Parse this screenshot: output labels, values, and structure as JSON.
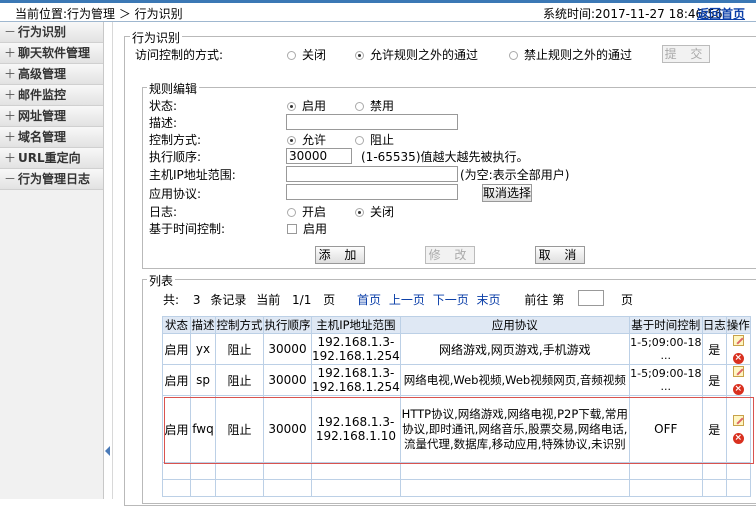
{
  "topbar": {
    "location": "当前位置:行为管理 ＞ 行为识别",
    "system_time": "系统时间:2017-11-27 18:46:56",
    "home": "返回首页"
  },
  "sidebar": {
    "items": [
      {
        "label": "行为识别",
        "glyph": "－"
      },
      {
        "label": "聊天软件管理",
        "glyph": "＋"
      },
      {
        "label": "高级管理",
        "glyph": "＋"
      },
      {
        "label": "邮件监控",
        "glyph": "＋"
      },
      {
        "label": "网址管理",
        "glyph": "＋"
      },
      {
        "label": "域名管理",
        "glyph": "＋"
      },
      {
        "label": "URL重定向",
        "glyph": "＋"
      },
      {
        "label": "行为管理日志",
        "glyph": "－"
      }
    ]
  },
  "section": {
    "legend": "行为识别",
    "access_label": "访问控制的方式:",
    "opt_off": "关闭",
    "opt_allow_except": "允许规则之外的通过",
    "opt_deny_except": "禁止规则之外的通过",
    "submit": "提 交"
  },
  "rule": {
    "legend": "规则编辑",
    "status_label": "状态:",
    "status_on": "启用",
    "status_off": "禁用",
    "desc_label": "描述:",
    "desc_value": "",
    "control_label": "控制方式:",
    "control_allow": "允许",
    "control_block": "阻止",
    "order_label": "执行顺序:",
    "order_value": "30000",
    "order_hint": "(1-65535)值越大越先被执行。",
    "ip_label": "主机IP地址范围:",
    "ip_value": "",
    "ip_hint": "(为空:表示全部用户)",
    "proto_label": "应用协议:",
    "proto_value": "",
    "proto_cancel": "取消选择",
    "log_label": "日志:",
    "log_on": "开启",
    "log_off": "关闭",
    "time_label": "基于时间控制:",
    "time_enable": "启用",
    "btn_add": "添 加",
    "btn_edit": "修 改",
    "btn_cancel": "取 消"
  },
  "list": {
    "legend": "列表",
    "total_prefix": "共:",
    "total": "3",
    "total_suffix": "条记录",
    "current_label": "当前",
    "page": "1/1",
    "page_suffix": "页",
    "first": "首页",
    "prev": "上一页",
    "next": "下一页",
    "last": "末页",
    "goto_label": "前往 第",
    "goto_value": "",
    "goto_suffix": "页",
    "headers": [
      "状态",
      "描述",
      "控制方式",
      "执行顺序",
      "主机IP地址范围",
      "应用协议",
      "基于时间控制",
      "日志",
      "操作"
    ],
    "rows": [
      {
        "status": "启用",
        "desc": "yx",
        "control": "阻止",
        "order": "30000",
        "ip": "192.168.1.3-192.168.1.254",
        "proto": "网络游戏,网页游戏,手机游戏",
        "time": "1-5;09:00-18 ...",
        "log": "是"
      },
      {
        "status": "启用",
        "desc": "sp",
        "control": "阻止",
        "order": "30000",
        "ip": "192.168.1.3-192.168.1.254",
        "proto": "网络电视,Web视频,Web视频网页,音频视频",
        "time": "1-5;09:00-18 ...",
        "log": "是"
      },
      {
        "status": "启用",
        "desc": "fwq",
        "control": "阻止",
        "order": "30000",
        "ip": "192.168.1.3-192.168.1.10",
        "proto": "HTTP协议,网络游戏,网络电视,P2P下载,常用协议,即时通讯,网络音乐,股票交易,网络电话,流量代理,数据库,移动应用,特殊协议,未识别",
        "time": "OFF",
        "log": "是"
      }
    ]
  },
  "colors": {
    "accent": "#3b78b5",
    "link": "#0a3ea8",
    "highlight": "#d9534f"
  }
}
